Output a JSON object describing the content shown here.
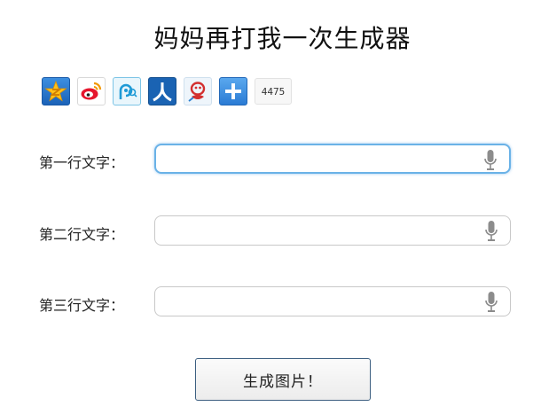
{
  "page": {
    "title": "妈妈再打我一次生成器"
  },
  "share": {
    "icons": [
      {
        "name": "qzone-icon",
        "color": "#f6b400"
      },
      {
        "name": "weibo-icon",
        "color": "#e6162d"
      },
      {
        "name": "tencent-weibo-icon",
        "color": "#2aa0d8"
      },
      {
        "name": "renren-icon",
        "color": "#1d64b0"
      },
      {
        "name": "tencent-friend-icon",
        "color": "#d32f2f"
      },
      {
        "name": "more-share-icon",
        "color": "#2e8ae0"
      }
    ],
    "count": "4475"
  },
  "form": {
    "line1_label": "第一行文字：",
    "line1_value": "",
    "line2_label": "第二行文字：",
    "line2_value": "",
    "line3_label": "第三行文字：",
    "line3_value": "",
    "mic_icon": "microphone-icon",
    "focus_color": "#6ab2e7"
  },
  "actions": {
    "generate_label": "生成图片！"
  }
}
